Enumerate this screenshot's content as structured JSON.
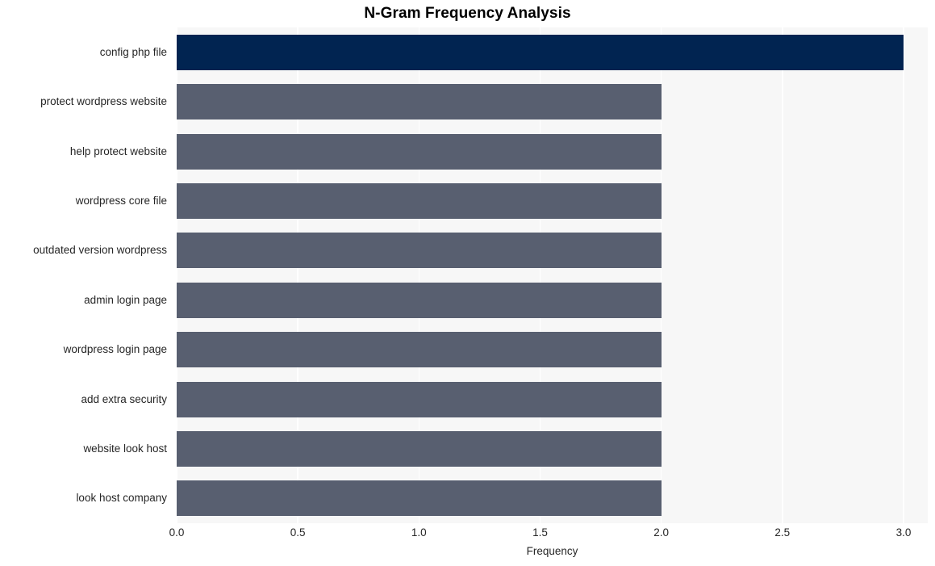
{
  "chart_data": {
    "type": "bar",
    "orientation": "horizontal",
    "title": "N-Gram Frequency Analysis",
    "xlabel": "Frequency",
    "ylabel": "",
    "categories": [
      "config php file",
      "protect wordpress website",
      "help protect website",
      "wordpress core file",
      "outdated version wordpress",
      "admin login page",
      "wordpress login page",
      "add extra security",
      "website look host",
      "look host company"
    ],
    "values": [
      3,
      2,
      2,
      2,
      2,
      2,
      2,
      2,
      2,
      2
    ],
    "bar_colors": [
      "#012451",
      "#585f70",
      "#585f70",
      "#585f70",
      "#585f70",
      "#585f70",
      "#585f70",
      "#585f70",
      "#585f70",
      "#585f70"
    ],
    "xlim": [
      0,
      3.1
    ],
    "xticks": [
      0,
      0.5,
      1,
      1.5,
      2,
      2.5,
      3
    ],
    "xtick_labels": [
      "0.0",
      "0.5",
      "1.0",
      "1.5",
      "2.0",
      "2.5",
      "3.0"
    ],
    "grid": true,
    "grid_axis": "x",
    "legend": null,
    "plot_background": "#f7f7f7",
    "grid_color": "#ffffff",
    "figure_background": "#ffffff"
  }
}
